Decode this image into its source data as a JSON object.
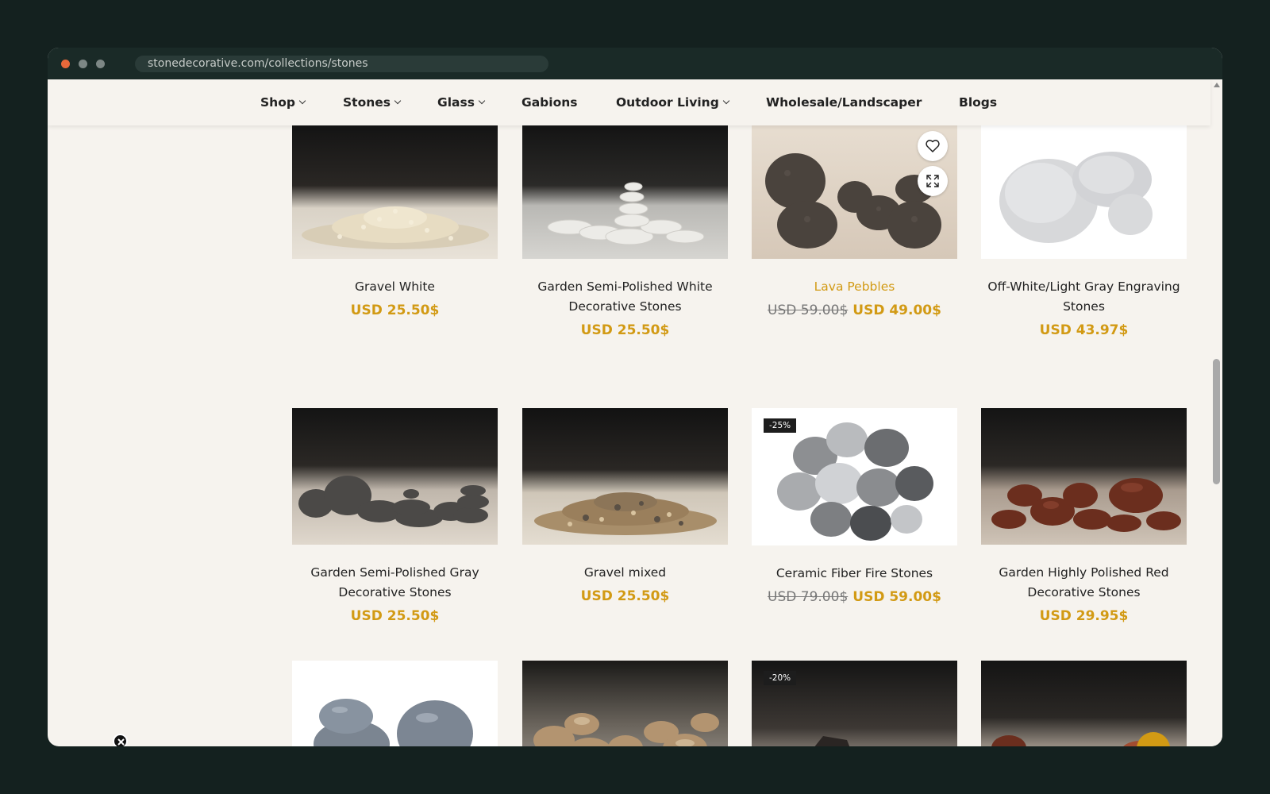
{
  "browser": {
    "url": "stonedecorative.com/collections/stones",
    "dots": [
      "#e8683a",
      "#7d8785",
      "#7d8785"
    ]
  },
  "nav": {
    "items": [
      {
        "label": "Shop",
        "dropdown": true
      },
      {
        "label": "Stones",
        "dropdown": true
      },
      {
        "label": "Glass",
        "dropdown": true
      },
      {
        "label": "Gabions",
        "dropdown": false
      },
      {
        "label": "Outdoor Living",
        "dropdown": true
      },
      {
        "label": "Wholesale/Landscaper",
        "dropdown": false
      },
      {
        "label": "Blogs",
        "dropdown": false
      }
    ]
  },
  "colors": {
    "accent": "#d29a14",
    "text": "#222222",
    "background": "#f6f3ee"
  },
  "products": [
    {
      "name": "Gravel White",
      "price": "USD 25.50$",
      "old_price": "",
      "badge": "",
      "highlight": false,
      "image": "white-gravel"
    },
    {
      "name": "Garden Semi-Polished White Decorative Stones",
      "price": "USD 25.50$",
      "old_price": "",
      "badge": "",
      "highlight": false,
      "image": "white-pebbles"
    },
    {
      "name": "Lava Pebbles",
      "price": "USD 49.00$",
      "old_price": "USD 59.00$",
      "badge": "",
      "highlight": true,
      "image": "lava-pebbles"
    },
    {
      "name": "Off-White/Light Gray Engraving Stones",
      "price": "USD 43.97$",
      "old_price": "",
      "badge": "",
      "highlight": false,
      "image": "light-gray-stones"
    },
    {
      "name": "Garden Semi-Polished Gray Decorative Stones",
      "price": "USD 25.50$",
      "old_price": "",
      "badge": "",
      "highlight": false,
      "image": "gray-pebbles"
    },
    {
      "name": "Gravel mixed",
      "price": "USD 25.50$",
      "old_price": "",
      "badge": "",
      "highlight": false,
      "image": "mixed-gravel"
    },
    {
      "name": "Ceramic Fiber Fire Stones",
      "price": "USD 59.00$",
      "old_price": "USD 79.00$",
      "badge": "-25%",
      "highlight": false,
      "image": "fire-stones"
    },
    {
      "name": "Garden Highly Polished Red Decorative Stones",
      "price": "USD 29.95$",
      "old_price": "",
      "badge": "",
      "highlight": false,
      "image": "red-pebbles"
    },
    {
      "name": "",
      "price": "",
      "old_price": "",
      "badge": "",
      "highlight": false,
      "image": "gray-polished-stones"
    },
    {
      "name": "",
      "price": "",
      "old_price": "",
      "badge": "",
      "highlight": false,
      "image": "beige-pebbles"
    },
    {
      "name": "",
      "price": "",
      "old_price": "",
      "badge": "-20%",
      "highlight": false,
      "image": "lava-rocks"
    },
    {
      "name": "",
      "price": "",
      "old_price": "",
      "badge": "",
      "highlight": false,
      "image": "mixed-polished-pebbles"
    }
  ],
  "icons": {
    "wishlist": "heart-icon",
    "quickview": "expand-icon",
    "close": "close-icon",
    "back_to_top": "arrow-up-icon"
  }
}
